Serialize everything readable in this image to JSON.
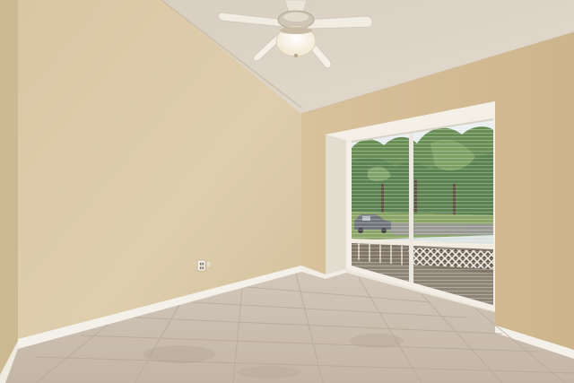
{
  "scene": {
    "kind": "interior-photo",
    "room": "empty bedroom",
    "features": [
      "ceiling-fan",
      "vaulted-ceiling",
      "large-window",
      "horizontal-blinds",
      "tile-floor",
      "baseboards",
      "wall-outlet"
    ],
    "colors": {
      "wall_left": "#dccaa8",
      "wall_right": "#d7c099",
      "ceiling": "#dcd3c5",
      "floor": "#cbbfb1",
      "baseboard": "#f4f1ea",
      "window_frame": "#f1ede4",
      "foliage": "#4e7a3a",
      "sky": "#dfe6ea"
    }
  }
}
